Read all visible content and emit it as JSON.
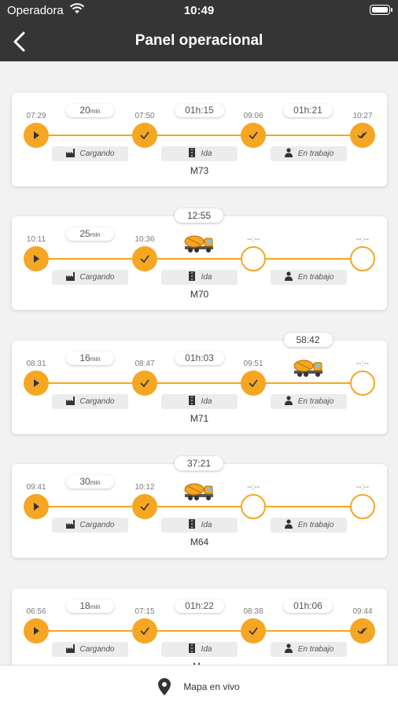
{
  "status_bar": {
    "carrier": "Operadora",
    "time": "10:49"
  },
  "header": {
    "title": "Panel operacional"
  },
  "stage_labels": [
    "Cargando",
    "Ida",
    "En trabajo"
  ],
  "cards": [
    {
      "truck": "M73",
      "times": [
        "07:29",
        "07:50",
        "09:06",
        "10:27"
      ],
      "durations": [
        {
          "value": "20",
          "unit": "min"
        },
        {
          "value": "01h:15",
          "unit": ""
        },
        {
          "value": "01h:21",
          "unit": ""
        }
      ],
      "nodes": [
        "play",
        "check",
        "check",
        "double-check"
      ],
      "truck_at": null,
      "elapsed": null
    },
    {
      "truck": "M70",
      "times": [
        "10:11",
        "10:36",
        "--:--",
        "--:--"
      ],
      "durations": [
        {
          "value": "25",
          "unit": "min"
        }
      ],
      "nodes": [
        "play",
        "check",
        "empty",
        "empty"
      ],
      "truck_at": 1,
      "elapsed": "12:55"
    },
    {
      "truck": "M71",
      "times": [
        "08:31",
        "08:47",
        "09:51",
        "--:--"
      ],
      "durations": [
        {
          "value": "16",
          "unit": "min"
        },
        {
          "value": "01h:03",
          "unit": ""
        }
      ],
      "nodes": [
        "play",
        "check",
        "check",
        "empty"
      ],
      "truck_at": 2,
      "elapsed": "58:42"
    },
    {
      "truck": "M64",
      "times": [
        "09:41",
        "10:12",
        "--:--",
        "--:--"
      ],
      "durations": [
        {
          "value": "30",
          "unit": "min"
        }
      ],
      "nodes": [
        "play",
        "check",
        "empty",
        "empty"
      ],
      "truck_at": 1,
      "elapsed": "37:21"
    },
    {
      "truck": "M..",
      "times": [
        "06:56",
        "07:15",
        "08:38",
        "09:44"
      ],
      "durations": [
        {
          "value": "18",
          "unit": "min"
        },
        {
          "value": "01h:22",
          "unit": ""
        },
        {
          "value": "01h:06",
          "unit": ""
        }
      ],
      "nodes": [
        "play",
        "check",
        "check",
        "double-check"
      ],
      "truck_at": null,
      "elapsed": null
    }
  ],
  "bottom_bar": {
    "label": "Mapa en vivo",
    "icon": "map-pin-icon"
  },
  "colors": {
    "accent": "#f5a623",
    "header": "#353535"
  }
}
